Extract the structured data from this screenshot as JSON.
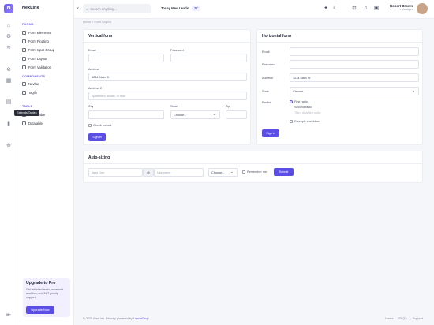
{
  "app": {
    "name": "NexLink",
    "logo_letter": "N"
  },
  "rail_icons": [
    "home-icon",
    "gear-icon",
    "layers-icon",
    "rocket-icon",
    "grid-icon",
    "table-icon",
    "chart-icon",
    "plus-icon"
  ],
  "sidebar": {
    "sections": [
      {
        "title": "FORMS",
        "items": [
          "Form Elements",
          "Form Floating",
          "Form Input Group",
          "Form Layout",
          "Form Validation"
        ]
      },
      {
        "title": "COMPONENTS",
        "items": [
          "Navbar",
          "Tagify"
        ]
      },
      {
        "title": "TABLE",
        "items": [
          "Basic Table",
          "Datatable"
        ]
      }
    ],
    "tooltip": "Extends Tables"
  },
  "promo": {
    "title": "Upgrade to Pro",
    "desc": "Get unlimited leads, advanced analytics, and 24/7 priority support.",
    "button": "Upgrade Now"
  },
  "topbar": {
    "search_placeholder": "Search anything...",
    "leads_label": "Today New Leads",
    "leads_count": "27",
    "user_name": "Robert Brown",
    "user_role": "• Manager"
  },
  "breadcrumb": "Home  >  Form Layout",
  "vertical_form": {
    "title": "Vertical form",
    "email_label": "Email",
    "password_label": "Password",
    "address_label": "Address",
    "address_value": "1234 Main St",
    "address2_label": "Address 2",
    "address2_placeholder": "Apartment, studio, or floor",
    "city_label": "City",
    "state_label": "State",
    "state_value": "Choose...",
    "zip_label": "Zip",
    "check_label": "Check me out",
    "button": "Sign in"
  },
  "horizontal_form": {
    "title": "Horizontal form",
    "email_label": "Email",
    "password_label": "Password",
    "address_label": "Address",
    "address_value": "1234 Main St",
    "state_label": "State",
    "state_value": "Choose...",
    "radios_label": "Radios",
    "radio1": "First radio",
    "radio2": "Second radio",
    "radio3": "Third disabled radio",
    "check_label": "Example checkbox",
    "button": "Sign in"
  },
  "autosizing": {
    "title": "Auto-sizing",
    "name_placeholder": "Jane Doe",
    "at": "@",
    "username_placeholder": "Username",
    "choose": "Choose...",
    "remember": "Remember me",
    "button": "Submit"
  },
  "footer": {
    "text": "© 2025 NexLink. Proudly powered by ",
    "link": "LayoutDrop",
    "links": [
      "Home",
      "FAQ's",
      "Support"
    ]
  }
}
